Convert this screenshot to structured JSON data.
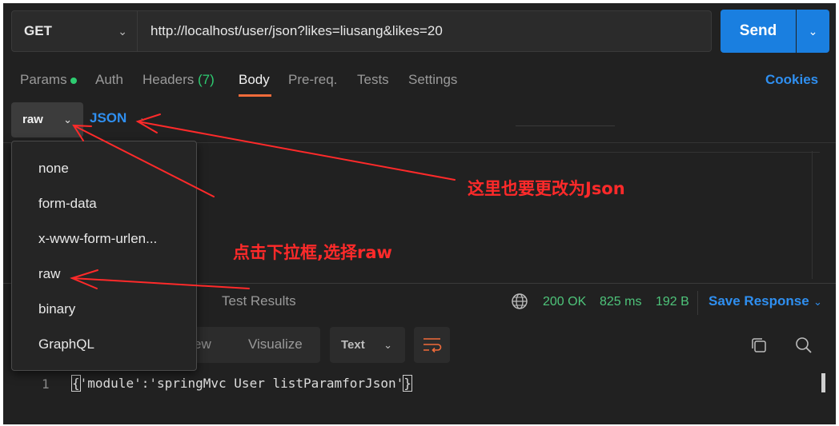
{
  "request": {
    "method": "GET",
    "url": "http://localhost/user/json?likes=liusang&likes=20",
    "send_label": "Send"
  },
  "tabs": [
    {
      "label": "Params"
    },
    {
      "label": "Auth"
    },
    {
      "label": "Headers",
      "count": "(7)"
    },
    {
      "label": "Body",
      "active": true
    },
    {
      "label": "Pre-req."
    },
    {
      "label": "Tests"
    },
    {
      "label": "Settings"
    }
  ],
  "cookies_label": "Cookies",
  "body_type": {
    "selected": "raw",
    "format": "JSON"
  },
  "body_type_menu": {
    "items": [
      "none",
      "form-data",
      "x-www-form-urlen...",
      "raw",
      "binary",
      "GraphQL"
    ]
  },
  "response": {
    "paren_fragment": ")",
    "test_results_label": "Test Results",
    "status": "200 OK",
    "time": "825 ms",
    "size": "192 B",
    "save_label": "Save Response",
    "view_tabs": {
      "pretty_fragment": "ew",
      "visualize": "Visualize"
    },
    "format_select": "Text",
    "line_number": "1",
    "open_brace": "{",
    "body_text": "'module':'springMvc User listParamforJson'",
    "close_brace": "}"
  },
  "annotations": {
    "json_note": "这里也要更改为Json",
    "raw_note": "点击下拉框,选择raw",
    "color": "#ff2a2a"
  },
  "colors": {
    "accent_blue": "#1a7fe0",
    "link_blue": "#2f8ff0",
    "active_tab_underline": "#f26b3a",
    "status_green": "#4ec47a",
    "background": "#212121"
  }
}
